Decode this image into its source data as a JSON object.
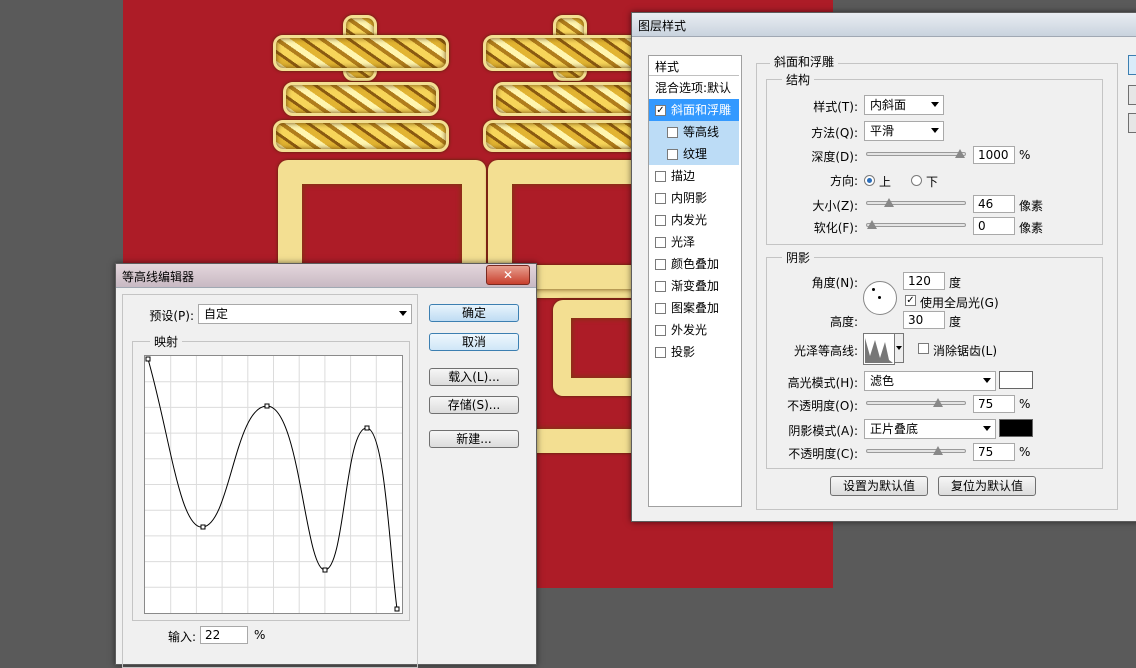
{
  "canvas": {
    "background": "#ad1c27",
    "artwork": "gold double-happiness character"
  },
  "layer_style": {
    "title": "图层样式",
    "styles_header": "样式",
    "styles_list": [
      {
        "label": "混合选项:默认",
        "checkbox": false,
        "checked": false,
        "state": "normal"
      },
      {
        "label": "斜面和浮雕",
        "checkbox": true,
        "checked": true,
        "state": "selected"
      },
      {
        "label": "等高线",
        "checkbox": true,
        "checked": false,
        "state": "sub"
      },
      {
        "label": "纹理",
        "checkbox": true,
        "checked": false,
        "state": "sub"
      },
      {
        "label": "描边",
        "checkbox": true,
        "checked": false,
        "state": "normal"
      },
      {
        "label": "内阴影",
        "checkbox": true,
        "checked": false,
        "state": "normal"
      },
      {
        "label": "内发光",
        "checkbox": true,
        "checked": false,
        "state": "normal"
      },
      {
        "label": "光泽",
        "checkbox": true,
        "checked": false,
        "state": "normal"
      },
      {
        "label": "颜色叠加",
        "checkbox": true,
        "checked": false,
        "state": "normal"
      },
      {
        "label": "渐变叠加",
        "checkbox": true,
        "checked": false,
        "state": "normal"
      },
      {
        "label": "图案叠加",
        "checkbox": true,
        "checked": false,
        "state": "normal"
      },
      {
        "label": "外发光",
        "checkbox": true,
        "checked": false,
        "state": "normal"
      },
      {
        "label": "投影",
        "checkbox": true,
        "checked": false,
        "state": "normal"
      }
    ],
    "bevel": {
      "section_title": "斜面和浮雕",
      "structure_title": "结构",
      "style_label": "样式(T):",
      "style_value": "内斜面",
      "technique_label": "方法(Q):",
      "technique_value": "平滑",
      "depth_label": "深度(D):",
      "depth_value": "1000",
      "depth_unit": "%",
      "depth_level": 1.0,
      "direction_label": "方向:",
      "direction_up": "上",
      "direction_down": "下",
      "size_label": "大小(Z):",
      "size_value": "46",
      "size_unit": "像素",
      "size_level": 0.19,
      "soften_label": "软化(F):",
      "soften_value": "0",
      "soften_unit": "像素",
      "soften_level": 0.0
    },
    "shading": {
      "title": "阴影",
      "angle_label": "角度(N):",
      "angle_value": "120",
      "angle_unit": "度",
      "global_light_label": "使用全局光(G)",
      "altitude_label": "高度:",
      "altitude_value": "30",
      "altitude_unit": "度",
      "gloss_label": "光泽等高线:",
      "antialias_label": "消除锯齿(L)",
      "highlight_mode_label": "高光模式(H):",
      "highlight_mode_value": "滤色",
      "highlight_color": "#ffffff",
      "highlight_opacity_label": "不透明度(O):",
      "highlight_opacity_value": "75",
      "highlight_opacity_unit": "%",
      "highlight_opacity_level": 0.75,
      "shadow_mode_label": "阴影模式(A):",
      "shadow_mode_value": "正片叠底",
      "shadow_color": "#000000",
      "shadow_opacity_label": "不透明度(C):",
      "shadow_opacity_value": "75",
      "shadow_opacity_unit": "%",
      "shadow_opacity_level": 0.75
    },
    "make_default": "设置为默认值",
    "reset_default": "复位为默认值"
  },
  "contour_editor": {
    "title": "等高线编辑器",
    "close_glyph": "✕",
    "preset_label": "预设(P):",
    "preset_value": "自定",
    "mapping_title": "映射",
    "ok": "确定",
    "cancel": "取消",
    "load": "载入(L)...",
    "save": "存储(S)...",
    "new": "新建...",
    "input_label": "输入:",
    "input_value": "22",
    "input_unit": "%"
  }
}
